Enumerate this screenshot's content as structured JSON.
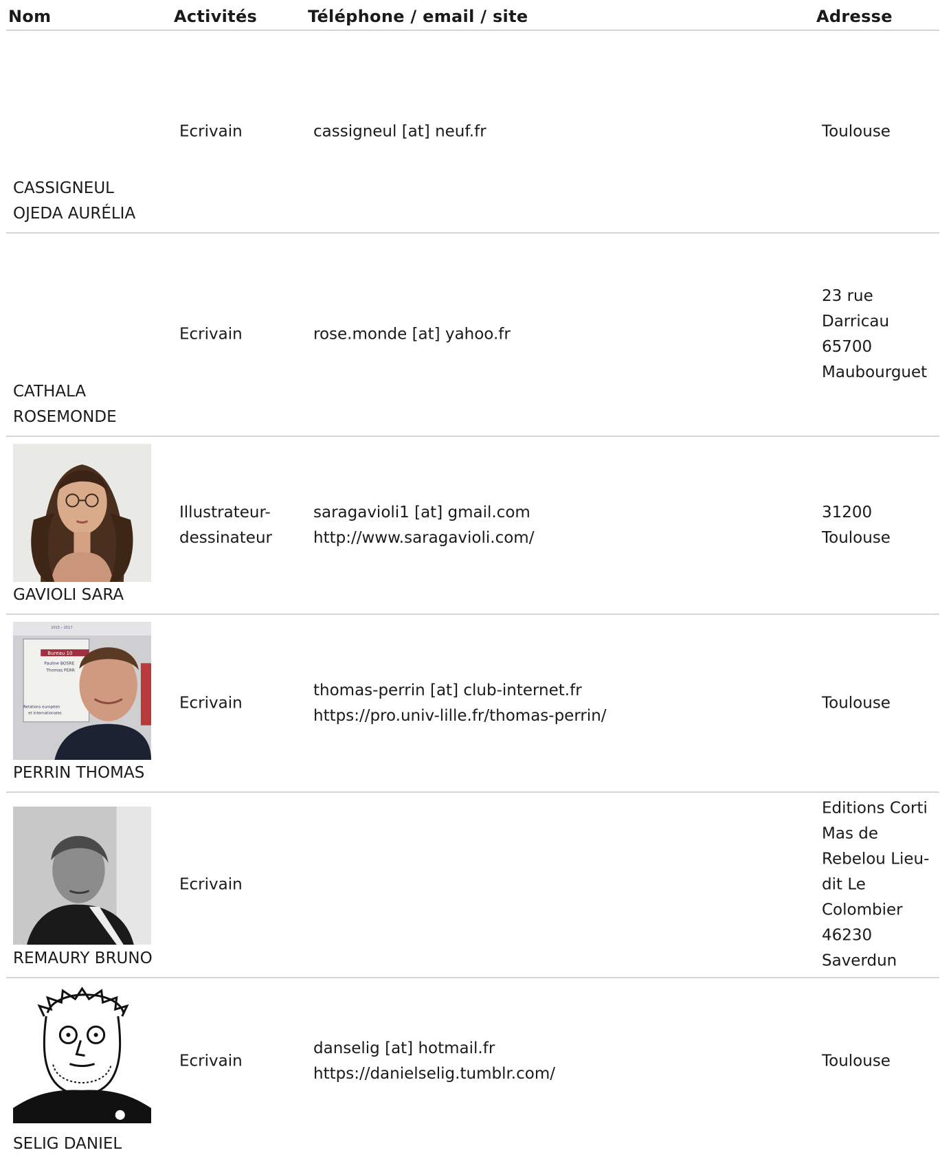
{
  "headers": {
    "nom": "Nom",
    "activites": "Activités",
    "contact": "Téléphone / email / site",
    "adresse": "Adresse"
  },
  "rows": [
    {
      "name_lines": [
        "CASSIGNEUL",
        "OJEDA AURÉLIA"
      ],
      "activity_lines": [
        "Ecrivain"
      ],
      "contact_lines": [
        "cassigneul [at] neuf.fr"
      ],
      "address_lines": [
        "Toulouse"
      ],
      "photo": null
    },
    {
      "name_lines": [
        "CATHALA",
        "ROSEMONDE"
      ],
      "activity_lines": [
        "Ecrivain"
      ],
      "contact_lines": [
        "rose.monde [at] yahoo.fr"
      ],
      "address_lines": [
        "23 rue",
        "Darricau",
        "65700",
        "Maubourguet"
      ],
      "photo": null
    },
    {
      "name_lines": [
        "GAVIOLI SARA"
      ],
      "activity_lines": [
        "Illustrateur-",
        "dessinateur"
      ],
      "contact_lines": [
        "saragavioli1 [at] gmail.com",
        "http://www.saragavioli.com/"
      ],
      "address_lines": [
        "31200",
        "Toulouse"
      ],
      "photo": "portrait-woman-glasses"
    },
    {
      "name_lines": [
        "PERRIN THOMAS"
      ],
      "activity_lines": [
        "Ecrivain"
      ],
      "contact_lines": [
        "thomas-perrin [at] club-internet.fr",
        "https://pro.univ-lille.fr/thomas-perrin/"
      ],
      "address_lines": [
        "Toulouse"
      ],
      "photo": "portrait-man-office",
      "photo_poster_lines": [
        "2015 – 2017",
        "Bureau 10",
        "Pauline BOSRE",
        "Thomas PERR",
        "Relations européen",
        "et internationales"
      ]
    },
    {
      "name_lines": [
        "REMAURY BRUNO"
      ],
      "activity_lines": [
        "Ecrivain"
      ],
      "contact_lines": [],
      "address_lines": [
        "Editions Corti",
        "Mas de",
        "Rebelou Lieu-",
        "dit Le",
        "Colombier",
        "46230",
        "Saverdun"
      ],
      "photo": "portrait-man-bw"
    },
    {
      "name_lines": [
        "SELIG DANIEL"
      ],
      "activity_lines": [
        "Ecrivain"
      ],
      "contact_lines": [
        "danselig [at] hotmail.fr",
        "https://danielselig.tumblr.com/"
      ],
      "address_lines": [
        "Toulouse"
      ],
      "photo": "cartoon-self-portrait"
    }
  ]
}
